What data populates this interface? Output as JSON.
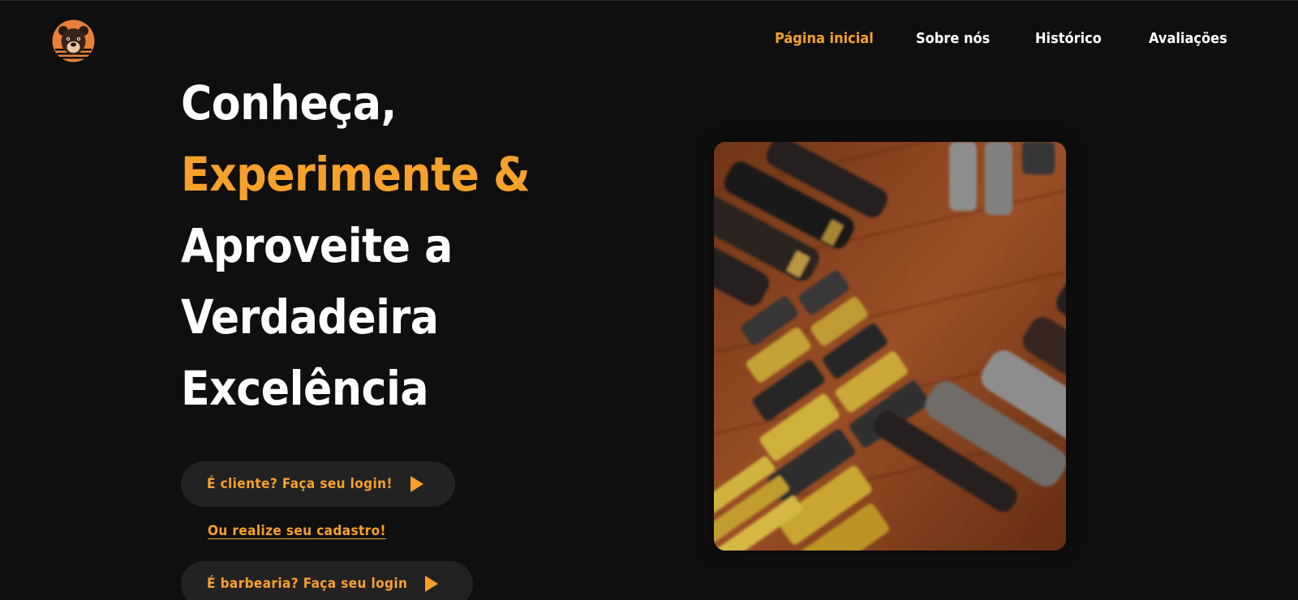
{
  "brand": {
    "logo_icon": "bear-face-logo-icon",
    "colors": {
      "accent": "#f7a12b",
      "background": "#0f0f0f",
      "button_bg": "#222222",
      "text": "#ffffff"
    }
  },
  "nav": {
    "items": [
      {
        "label": "Página inicial",
        "active": true
      },
      {
        "label": "Sobre nós",
        "active": false
      },
      {
        "label": "Histórico",
        "active": false
      },
      {
        "label": "Avaliações",
        "active": false
      }
    ]
  },
  "hero": {
    "line1": "Conheça,",
    "line2": "Experimente &",
    "line3": "Aproveite a",
    "line4": "Verdadeira",
    "line5": "Excelência"
  },
  "actions": {
    "client_login": "É cliente? Faça seu login!",
    "register_link": "Ou realize seu cadastro!",
    "barbershop_login": "É barbearia? Faça seu login",
    "play_icon": "play-triangle-icon"
  },
  "image": {
    "subject": "hair-clippers-photo"
  }
}
